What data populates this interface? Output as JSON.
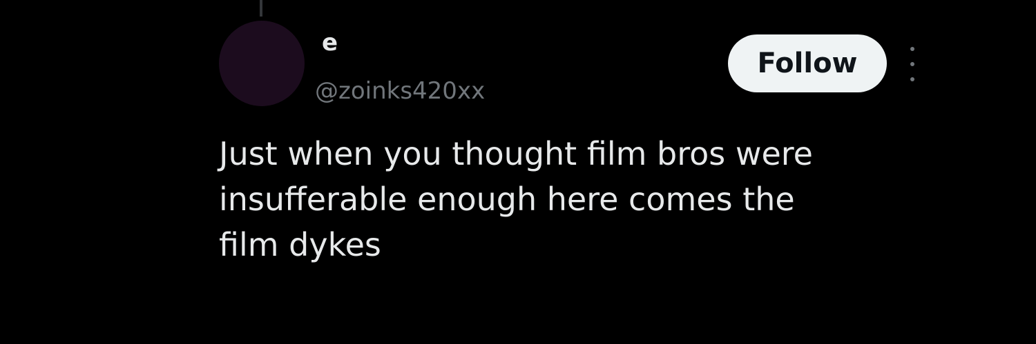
{
  "thread": {
    "connector_color": "#333639"
  },
  "author": {
    "display_name": "e",
    "handle": "@zoinks420xx",
    "avatar_color": "#1c0c1e"
  },
  "actions": {
    "follow_label": "Follow",
    "more_icon": "more-vertical-icon"
  },
  "tweet": {
    "text": "Just when you thought film bros were\ninsufferable enough here comes the\nfilm dykes"
  },
  "colors": {
    "background": "#000000",
    "primary_text": "#e7e9ea",
    "secondary_text": "#71767b",
    "follow_bg": "#eff3f4",
    "follow_text": "#0f1419"
  }
}
